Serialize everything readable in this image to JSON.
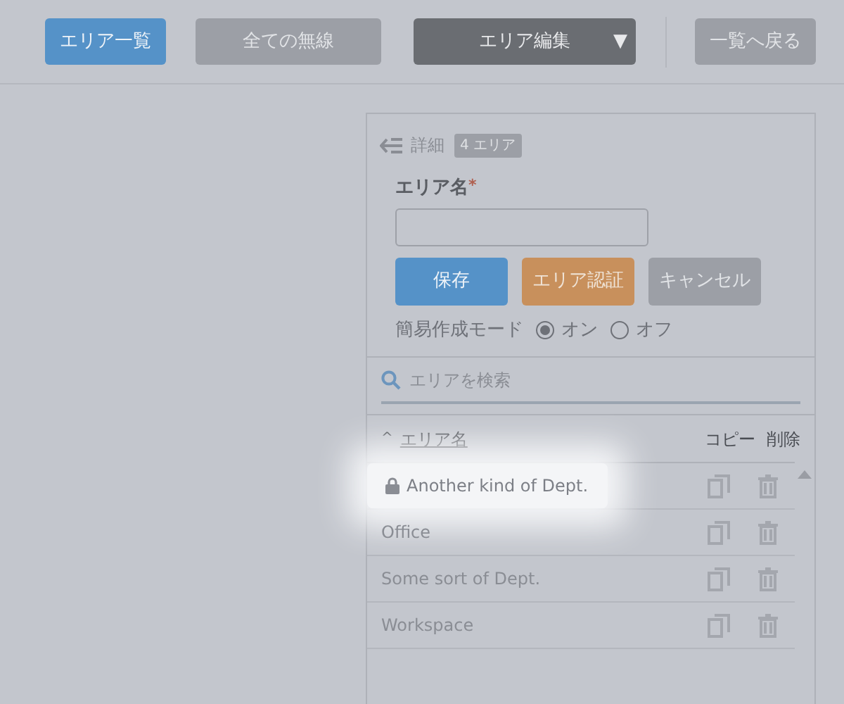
{
  "toolbar": {
    "buttons": [
      {
        "label": "エリア一覧",
        "kind": "primary"
      },
      {
        "label": "全ての無線",
        "kind": "disabled"
      },
      {
        "label": "エリア編集",
        "kind": "dropdown",
        "caret": "▼"
      },
      {
        "label": "一覧へ戻る",
        "kind": "disabled"
      }
    ]
  },
  "panel": {
    "back_label": "詳細",
    "badge": "4 エリア",
    "field": {
      "label": "エリア名",
      "required_mark": "*"
    },
    "buttons": [
      {
        "label": "保存",
        "kind": "primary"
      },
      {
        "label": "エリア認証",
        "kind": "warning"
      },
      {
        "label": "キャンセル",
        "kind": "disabled"
      }
    ],
    "mode": {
      "label": "簡易作成モード",
      "options": [
        {
          "label": "オン",
          "selected": true
        },
        {
          "label": "オフ",
          "selected": false
        }
      ]
    },
    "search": {
      "placeholder": "エリアを検索"
    },
    "table": {
      "sort_caret": "^",
      "columns": [
        "エリア名",
        "コピー",
        "削除"
      ],
      "rows": [
        {
          "name": "Another kind of Dept.",
          "locked": true,
          "highlighted": true
        },
        {
          "name": "Office",
          "locked": false,
          "highlighted": false
        },
        {
          "name": "Some sort of Dept.",
          "locked": false,
          "highlighted": false
        },
        {
          "name": "Workspace",
          "locked": false,
          "highlighted": false
        }
      ]
    }
  }
}
